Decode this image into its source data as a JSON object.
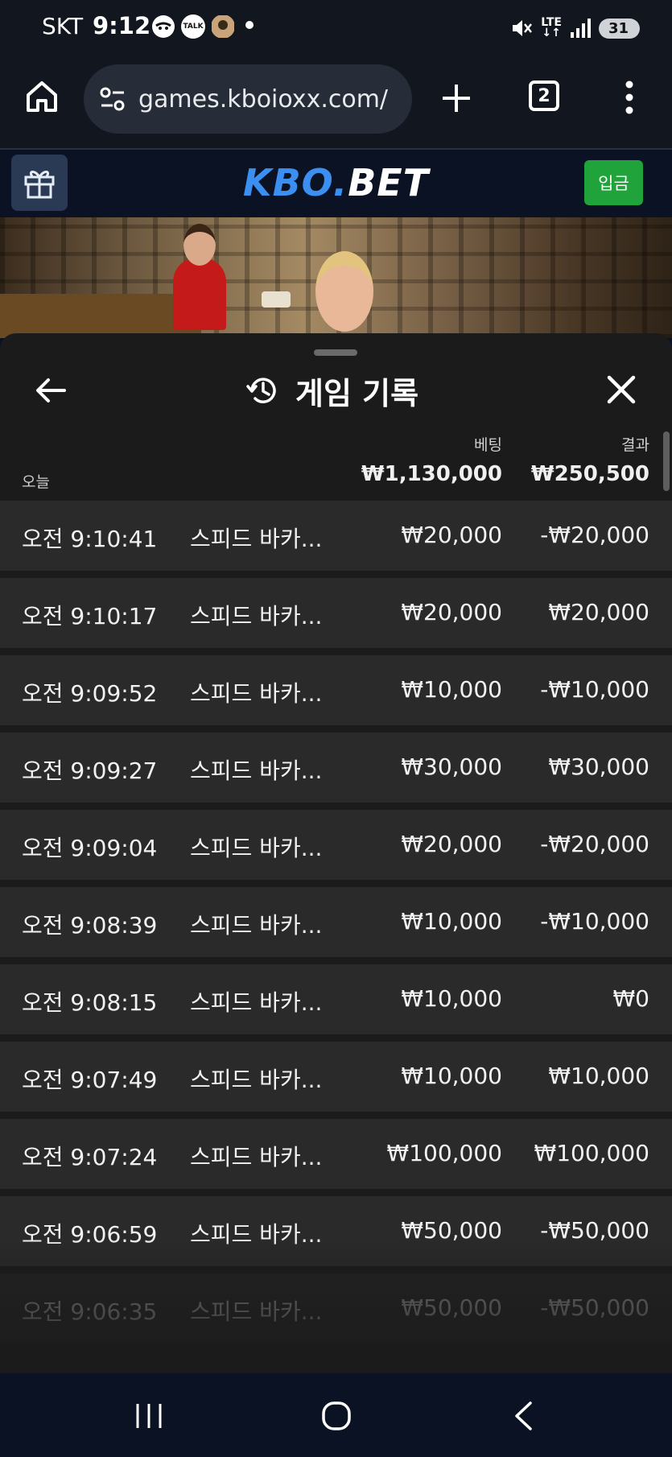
{
  "status_bar": {
    "carrier": "SKT",
    "time": "9:12",
    "notification_talk": "TALK",
    "network": "LTE",
    "battery": "31"
  },
  "browser": {
    "url": "games.kboioxx.com/",
    "tab_count": "2"
  },
  "site": {
    "logo_part1": "KBO.",
    "logo_part2": "BET",
    "deposit_label": "입금",
    "colors": {
      "logo_blue": "#3b8ff0",
      "deposit_green": "#1fa33a"
    }
  },
  "panel": {
    "title": "게임 기록",
    "date_label": "오늘",
    "bet_label": "베팅",
    "result_label": "결과",
    "total_bet": "₩1,130,000",
    "total_result": "₩250,500"
  },
  "rows": [
    {
      "time": "오전 9:10:41",
      "game": "스피드 바카...",
      "bet": "₩20,000",
      "result": "-₩20,000"
    },
    {
      "time": "오전 9:10:17",
      "game": "스피드 바카...",
      "bet": "₩20,000",
      "result": "₩20,000"
    },
    {
      "time": "오전 9:09:52",
      "game": "스피드 바카...",
      "bet": "₩10,000",
      "result": "-₩10,000"
    },
    {
      "time": "오전 9:09:27",
      "game": "스피드 바카...",
      "bet": "₩30,000",
      "result": "₩30,000"
    },
    {
      "time": "오전 9:09:04",
      "game": "스피드 바카...",
      "bet": "₩20,000",
      "result": "-₩20,000"
    },
    {
      "time": "오전 9:08:39",
      "game": "스피드 바카...",
      "bet": "₩10,000",
      "result": "-₩10,000"
    },
    {
      "time": "오전 9:08:15",
      "game": "스피드 바카...",
      "bet": "₩10,000",
      "result": "₩0"
    },
    {
      "time": "오전 9:07:49",
      "game": "스피드 바카...",
      "bet": "₩10,000",
      "result": "₩10,000"
    },
    {
      "time": "오전 9:07:24",
      "game": "스피드 바카...",
      "bet": "₩100,000",
      "result": "₩100,000"
    },
    {
      "time": "오전 9:06:59",
      "game": "스피드 바카...",
      "bet": "₩50,000",
      "result": "-₩50,000"
    },
    {
      "time": "오전 9:06:35",
      "game": "스피드 바카...",
      "bet": "₩50,000",
      "result": "-₩50,000"
    }
  ]
}
